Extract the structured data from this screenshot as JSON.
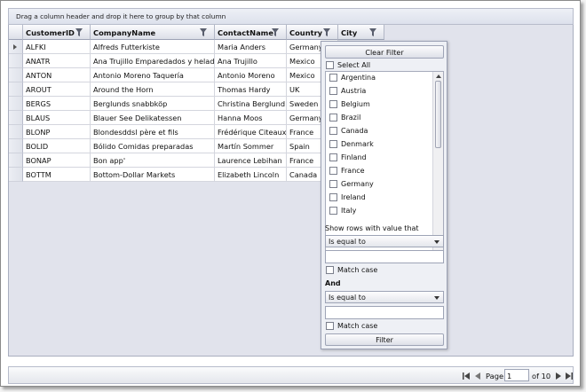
{
  "group_panel": {
    "hint": "Drag a column header and drop it here to group by that column"
  },
  "columns": [
    {
      "key": "id",
      "label": "CustomerID"
    },
    {
      "key": "company",
      "label": "CompanyName"
    },
    {
      "key": "contact",
      "label": "ContactName"
    },
    {
      "key": "country",
      "label": "Country"
    },
    {
      "key": "city",
      "label": "City"
    }
  ],
  "rows": [
    {
      "id": "ALFKI",
      "company": "Alfreds Futterkiste",
      "contact": "Maria Anders",
      "country": "Germany"
    },
    {
      "id": "ANATR",
      "company": "Ana Trujillo Emparedados y helados",
      "contact": "Ana Trujillo",
      "country": "Mexico"
    },
    {
      "id": "ANTON",
      "company": "Antonio Moreno Taquería",
      "contact": "Antonio Moreno",
      "country": "Mexico"
    },
    {
      "id": "AROUT",
      "company": "Around the Horn",
      "contact": "Thomas Hardy",
      "country": "UK"
    },
    {
      "id": "BERGS",
      "company": "Berglunds snabbköp",
      "contact": "Christina Berglund",
      "country": "Sweden"
    },
    {
      "id": "BLAUS",
      "company": "Blauer See Delikatessen",
      "contact": "Hanna Moos",
      "country": "Germany"
    },
    {
      "id": "BLONP",
      "company": "Blondesddsl père et fils",
      "contact": "Frédérique Citeaux",
      "country": "France"
    },
    {
      "id": "BOLID",
      "company": "Bólido Comidas preparadas",
      "contact": "Martín Sommer",
      "country": "Spain"
    },
    {
      "id": "BONAP",
      "company": "Bon app'",
      "contact": "Laurence Lebihan",
      "country": "France"
    },
    {
      "id": "BOTTM",
      "company": "Bottom-Dollar Markets",
      "contact": "Elizabeth Lincoln",
      "country": "Canada"
    }
  ],
  "filter": {
    "clear_label": "Clear Filter",
    "select_all": "Select All",
    "values": [
      "Argentina",
      "Austria",
      "Belgium",
      "Brazil",
      "Canada",
      "Denmark",
      "Finland",
      "France",
      "Germany",
      "Ireland",
      "Italy"
    ],
    "show_rows_label": "Show rows with value that",
    "op1": "Is equal to",
    "op1_value": "",
    "match_case1": "Match case",
    "and_label": "And",
    "op2": "Is equal to",
    "op2_value": "",
    "match_case2": "Match case",
    "apply_label": "Filter"
  },
  "pager": {
    "page_label": "Page",
    "page_value": "1",
    "of_label": "of 10"
  }
}
